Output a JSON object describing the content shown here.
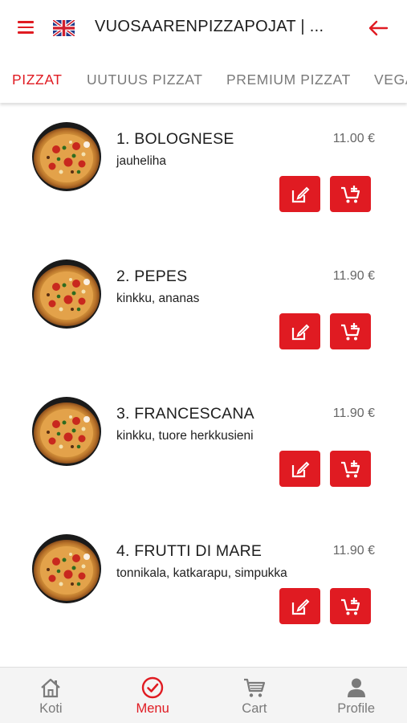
{
  "header": {
    "title": "VUOSAARENPIZZAPOJAT | ...",
    "language_icon": "uk-flag-icon",
    "menu_icon": "hamburger-icon",
    "back_icon": "back-arrow-icon"
  },
  "tabs": [
    {
      "label": "PIZZAT",
      "active": true
    },
    {
      "label": "UUTUUS PIZZAT",
      "active": false
    },
    {
      "label": "PREMIUM PIZZAT",
      "active": false
    },
    {
      "label": "VEGAANI",
      "active": false
    }
  ],
  "items": [
    {
      "name": "1. BOLOGNESE",
      "description": "jauheliha",
      "price": "11.00 €"
    },
    {
      "name": "2. PEPES",
      "description": "kinkku, ananas",
      "price": "11.90 €"
    },
    {
      "name": "3. FRANCESCANA",
      "description": "kinkku, tuore herkkusieni",
      "price": "11.90 €"
    },
    {
      "name": "4. FRUTTI DI MARE",
      "description": "tonnikala, katkarapu, simpukka",
      "price": "11.90 €"
    }
  ],
  "item_actions": {
    "edit_icon": "edit-icon",
    "cart_icon": "add-to-cart-icon"
  },
  "bottom_nav": [
    {
      "label": "Koti",
      "icon": "home-icon",
      "active": false
    },
    {
      "label": "Menu",
      "icon": "check-circle-icon",
      "active": true
    },
    {
      "label": "Cart",
      "icon": "cart-icon",
      "active": false
    },
    {
      "label": "Profile",
      "icon": "user-icon",
      "active": false
    }
  ],
  "colors": {
    "accent": "#e01b22",
    "inactive": "#7a7a7a",
    "nav_bg": "#f4f4f4"
  }
}
